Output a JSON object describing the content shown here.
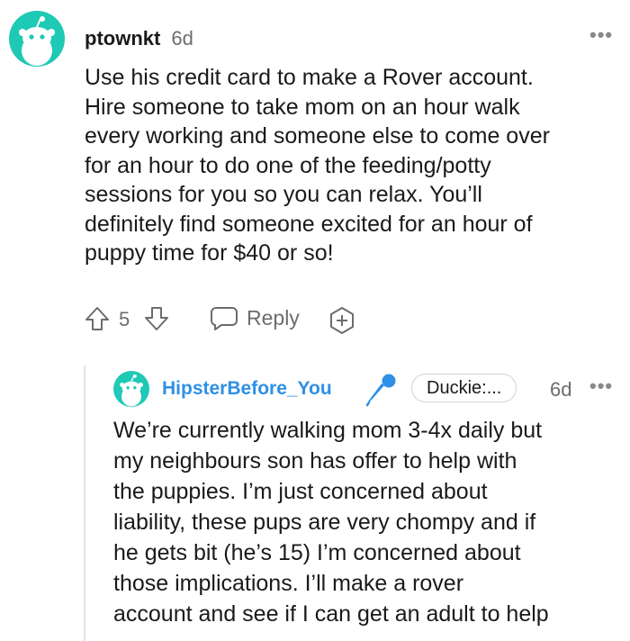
{
  "comment": {
    "username": "ptownkt",
    "age": "6d",
    "more_label": "•••",
    "avatar_color": "#1ec9b5",
    "body_lines": [
      "Use his credit card to make a Rover account.",
      "Hire someone to take mom on an hour walk",
      "every working and someone else to come over",
      "for an hour to do one of the feeding/potty",
      "sessions for you so you can relax. You’ll",
      "definitely find someone excited for an hour of",
      "puppy time for $40 or so!"
    ],
    "vote_count": "5",
    "reply_label": "Reply"
  },
  "reply": {
    "username": "HipsterBefore_You",
    "username_color": "#2e90e5",
    "flair": "Duckie:...",
    "age": "6d",
    "more_label": "•••",
    "avatar_color": "#1ec9b5",
    "body_lines": [
      "We’re currently walking mom 3-4x daily but",
      "my neighbours son has offer to help with",
      "the puppies. I’m just concerned about",
      "liability, these pups are very chompy and if",
      "he gets bit (he’s 15) I’m concerned about",
      "those implications. I’ll make a rover",
      "account and see if I can get an adult to help"
    ]
  }
}
